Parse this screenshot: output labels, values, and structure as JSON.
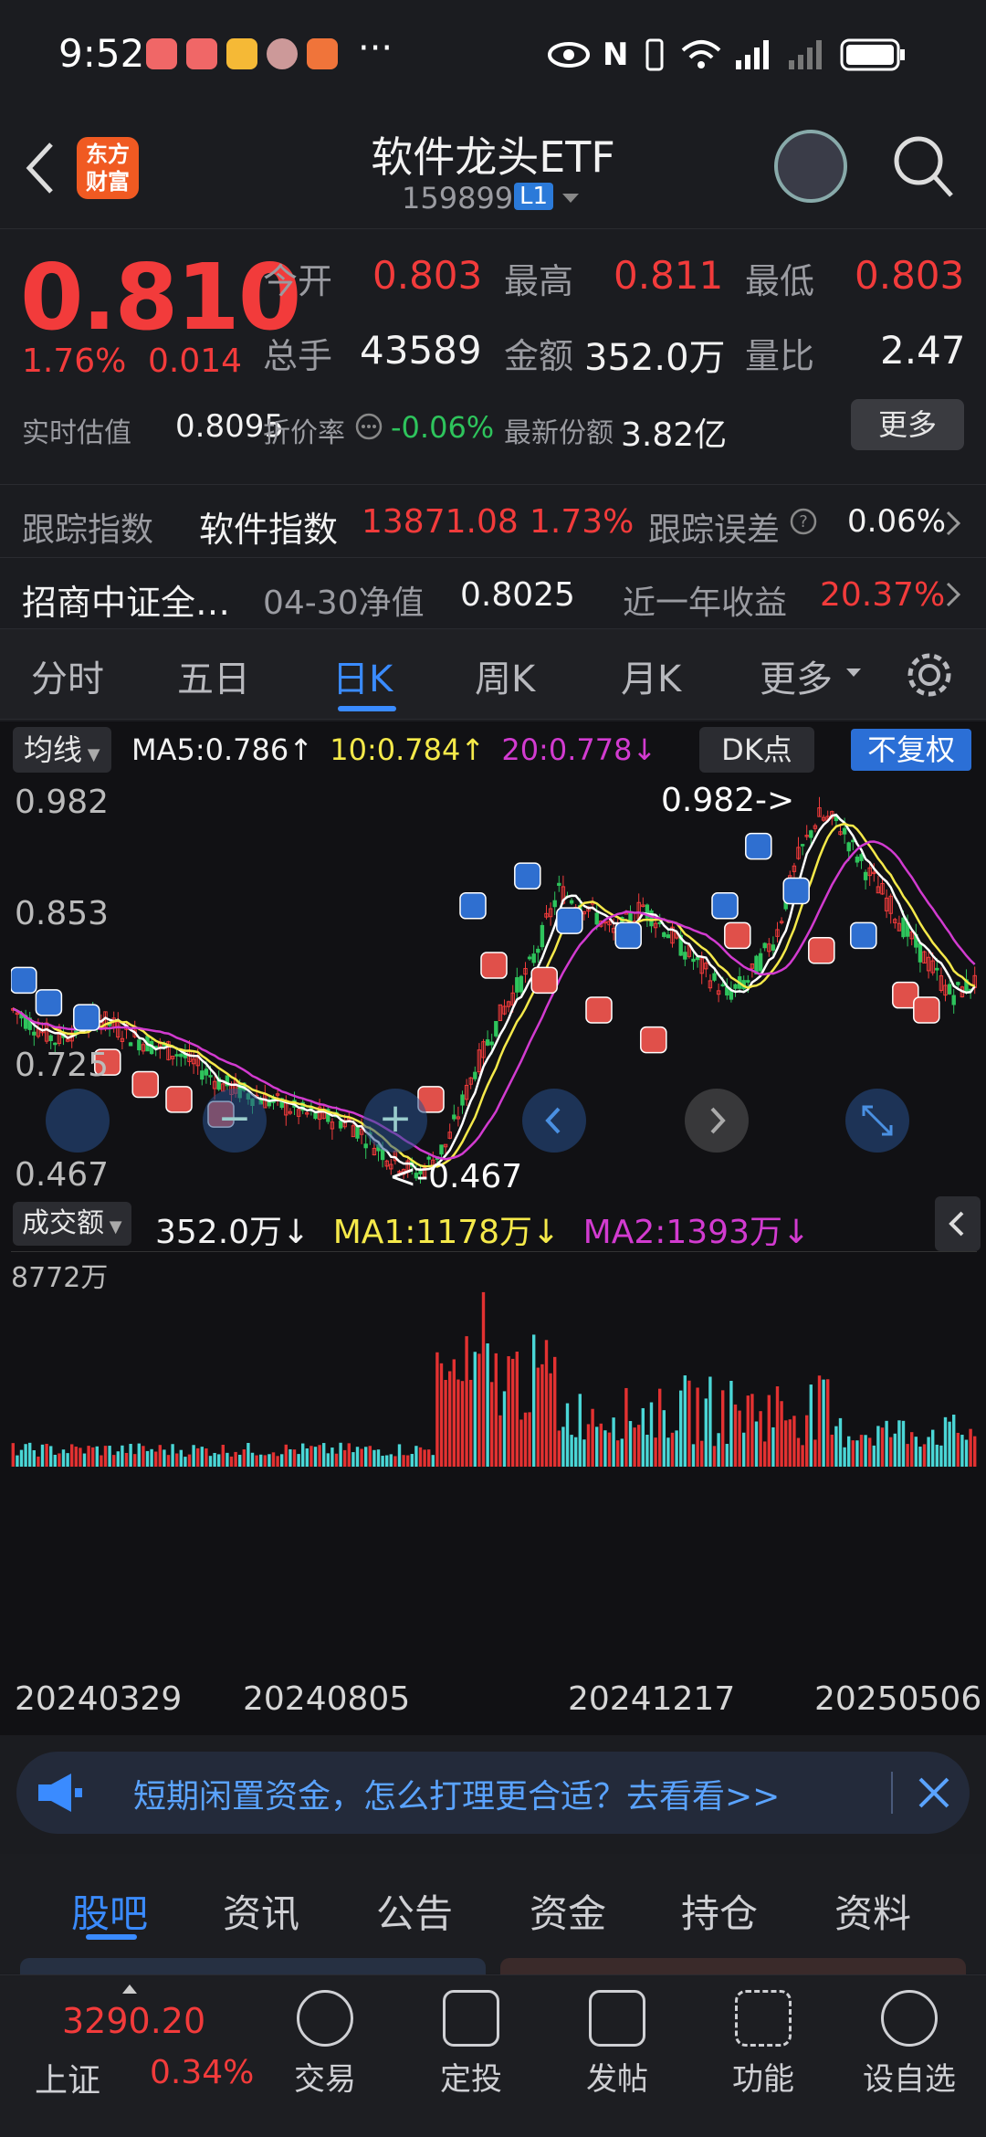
{
  "statusbar": {
    "time": "9:52",
    "more": "···",
    "signal": "5G"
  },
  "header": {
    "title": "软件龙头ETF",
    "code": "159899",
    "level": "L1",
    "logo_text": "东方财富"
  },
  "quote": {
    "price": "0.810",
    "pct": "1.76%",
    "change": "0.014",
    "open_label": "今开",
    "open": "0.803",
    "high_label": "最高",
    "high": "0.811",
    "low_label": "最低",
    "low": "0.803",
    "vol_label": "总手",
    "vol": "43589",
    "amt_label": "金额",
    "amt": "352.0万",
    "ratio_label": "量比",
    "ratio": "2.47",
    "est_label": "实时估值",
    "est": "0.8095",
    "disc_label": "折价率",
    "disc": "-0.06%",
    "share_label": "最新份额",
    "share": "3.82亿",
    "more_btn": "更多"
  },
  "track": {
    "label": "跟踪指数",
    "index": "软件指数",
    "value": "13871.08",
    "pct": "1.73%",
    "err_label": "跟踪误差",
    "err": "0.06%"
  },
  "fund": {
    "name": "招商中证全…",
    "nav_label": "04-30净值",
    "nav": "0.8025",
    "yr_label": "近一年收益",
    "yr": "20.37%"
  },
  "tabs": [
    "分时",
    "五日",
    "日K",
    "周K",
    "月K",
    "更多"
  ],
  "active_tab": "日K",
  "ma": {
    "btn": "均线",
    "ma5": "MA5:0.786↑",
    "ma10": "10:0.784↑",
    "ma20": "20:0.778↓",
    "dk": "DK点",
    "fq": "不复权"
  },
  "kline": {
    "y_labels": [
      "0.982",
      "0.853",
      "0.725",
      "0.467"
    ],
    "hi_note": "0.982->",
    "lo_note": "<-0.467"
  },
  "volume": {
    "btn": "成交额",
    "val": "352.0万↓",
    "ma1": "MA1:1178万↓",
    "ma2": "MA2:1393万↓",
    "max": "8772万",
    "dates": [
      "20240329",
      "20240805",
      "20241217",
      "20250506"
    ]
  },
  "chart_data": {
    "type": "bar",
    "title": "",
    "xlabel": "",
    "ylabel": "",
    "ylim": [
      0.467,
      0.982
    ],
    "price_high": 0.982,
    "price_low": 0.467
  },
  "banner": {
    "text": "短期闲置资金，怎么打理更合适？去看看>>"
  },
  "bottom_tabs": [
    "股吧",
    "资讯",
    "公告",
    "资金",
    "持仓",
    "资料"
  ],
  "index": {
    "value": "3290.20",
    "name": "上证",
    "pct": "0.34%"
  },
  "nav": [
    "交易",
    "定投",
    "发帖",
    "功能",
    "设自选"
  ],
  "colors": {
    "up": "#f23b3b",
    "down": "#2ec45c",
    "ma5": "#ffffff",
    "ma10": "#f5e94a",
    "ma20": "#d23bd0",
    "accent": "#3a8bff"
  }
}
